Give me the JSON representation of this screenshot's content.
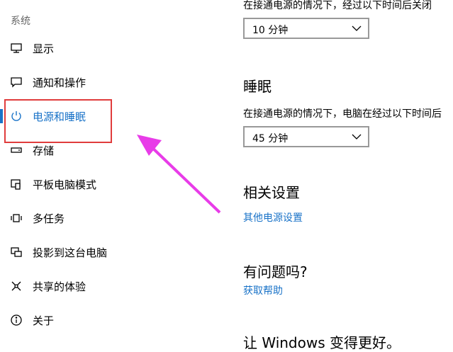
{
  "sidebar": {
    "section_title": "系统",
    "items": [
      {
        "label": "显示",
        "icon": "monitor-icon"
      },
      {
        "label": "通知和操作",
        "icon": "notification-icon"
      },
      {
        "label": "电源和睡眠",
        "icon": "power-icon",
        "active": true
      },
      {
        "label": "存储",
        "icon": "storage-icon"
      },
      {
        "label": "平板电脑模式",
        "icon": "tablet-mode-icon"
      },
      {
        "label": "多任务",
        "icon": "multitasking-icon"
      },
      {
        "label": "投影到这台电脑",
        "icon": "projecting-icon"
      },
      {
        "label": "共享的体验",
        "icon": "shared-experiences-icon"
      },
      {
        "label": "关于",
        "icon": "about-icon"
      }
    ]
  },
  "screen": {
    "description": "在接通电源的情况下，经过以下时间后关闭",
    "value": "10 分钟"
  },
  "sleep": {
    "heading": "睡眠",
    "description": "在接通电源的情况下，电脑在经过以下时间后",
    "value": "45 分钟"
  },
  "related": {
    "heading": "相关设置",
    "link": "其他电源设置"
  },
  "help": {
    "heading": "有问题吗?",
    "link": "获取帮助"
  },
  "feedback": {
    "heading": "让 Windows 变得更好。"
  },
  "colors": {
    "accent": "#1a73c8",
    "annotation_box": "#e03c3c",
    "annotation_arrow": "#e83ce8"
  }
}
